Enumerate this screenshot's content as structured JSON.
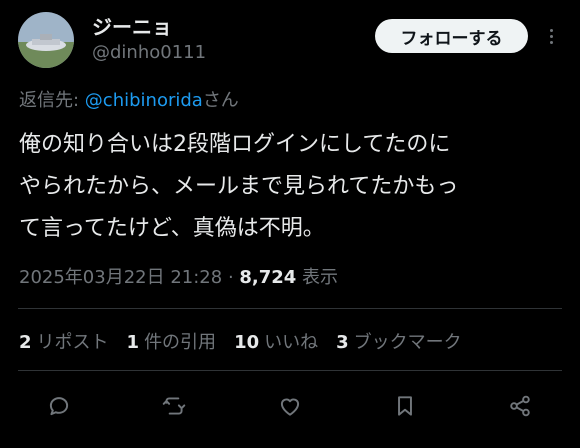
{
  "user": {
    "display_name": "ジーニョ",
    "handle": "@dinho0111",
    "avatar_icon": "avatar-photo"
  },
  "follow_button": "フォローする",
  "more_icon": "more-vertical-icon",
  "reply_to": {
    "prefix": "返信先: ",
    "mention": "@chibinorida",
    "suffix": "さん"
  },
  "tweet": {
    "lines": [
      "俺の知り合いは2段階ログインにしてたのに",
      "やられたから、メールまで見られてたかもっ",
      "て言ってたけど、真偽は不明。"
    ]
  },
  "meta": {
    "timestamp": "2025年03月22日 21:28",
    "separator": " · ",
    "views_count": "8,724",
    "views_label": " 表示"
  },
  "stats": {
    "reposts_count": "2",
    "reposts_label": "リポスト",
    "quotes_count": "1",
    "quotes_label": "件の引用",
    "likes_count": "10",
    "likes_label": "いいね",
    "bookmarks_count": "3",
    "bookmarks_label": "ブックマーク"
  },
  "actions": [
    "reply-icon",
    "repost-icon",
    "like-icon",
    "bookmark-icon",
    "share-icon"
  ],
  "colors": {
    "background": "#000000",
    "text": "#e7e9ea",
    "secondary": "#71767b",
    "link": "#1d9bf0",
    "divider": "#2f3336"
  }
}
